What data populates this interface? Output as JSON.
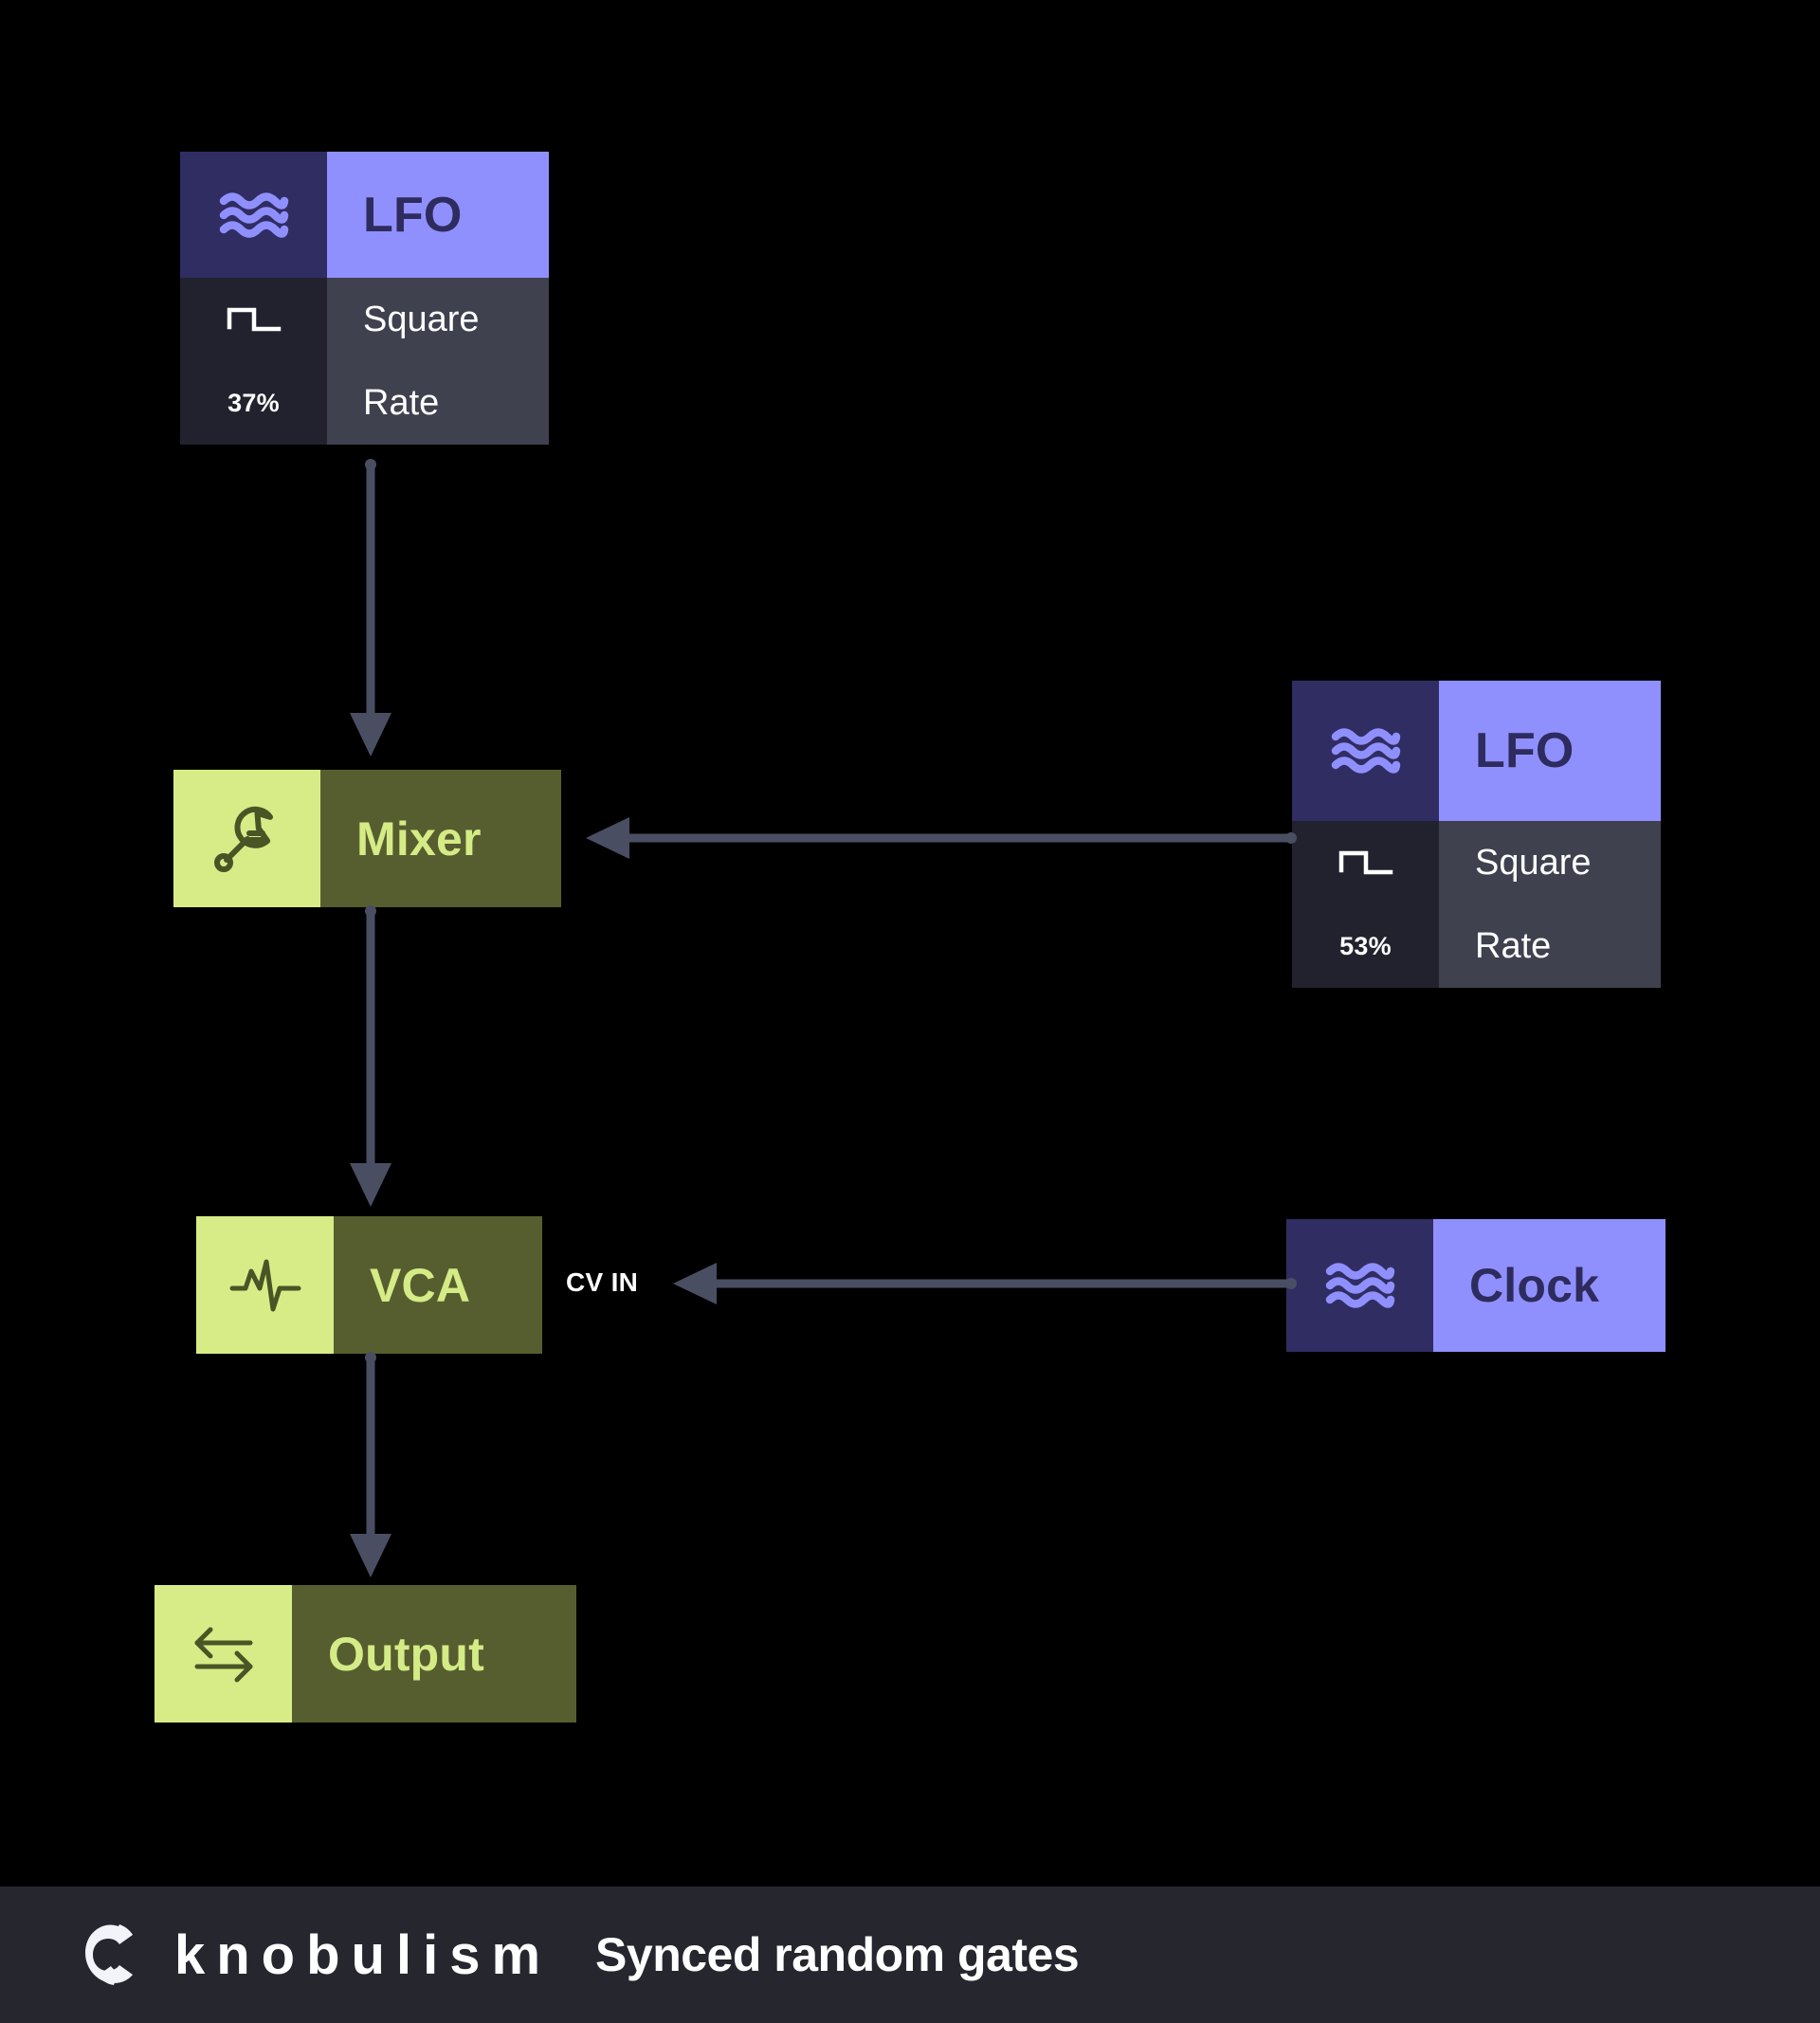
{
  "theme": {
    "background": "#000000",
    "accent_purple": "#8F90FD",
    "accent_purple_dark": "#302D62",
    "accent_lime": "#D7EC87",
    "accent_olive": "#565E30",
    "detail_icon_bg": "#22222E",
    "detail_label_bg": "#3F414F",
    "connector": "#4A4E63",
    "footer_bg": "#26262F",
    "text_light": "#FFFFFF"
  },
  "diagram": {
    "nodes": [
      {
        "id": "lfo-1",
        "title": "LFO",
        "icon": "waves-icon",
        "style": "purple",
        "details": [
          {
            "icon": "square-wave-icon",
            "label": "Square"
          },
          {
            "value": "37%",
            "label": "Rate"
          }
        ]
      },
      {
        "id": "mixer",
        "title": "Mixer",
        "icon": "wrench-icon",
        "style": "olive",
        "details": []
      },
      {
        "id": "lfo-2",
        "title": "LFO",
        "icon": "waves-icon",
        "style": "purple",
        "details": [
          {
            "icon": "square-wave-icon",
            "label": "Square"
          },
          {
            "value": "53%",
            "label": "Rate"
          }
        ]
      },
      {
        "id": "vca",
        "title": "VCA",
        "icon": "pulse-icon",
        "style": "olive",
        "details": []
      },
      {
        "id": "clock",
        "title": "Clock",
        "icon": "waves-icon",
        "style": "purple",
        "details": []
      },
      {
        "id": "output",
        "title": "Output",
        "icon": "exchange-arrows-icon",
        "style": "olive",
        "details": []
      }
    ],
    "edges": [
      {
        "id": "lfo1-to-mixer",
        "from": "lfo-1",
        "to": "mixer",
        "label": ""
      },
      {
        "id": "lfo2-to-mixer",
        "from": "lfo-2",
        "to": "mixer",
        "label": ""
      },
      {
        "id": "mixer-to-vca",
        "from": "mixer",
        "to": "vca",
        "label": ""
      },
      {
        "id": "clock-to-vca",
        "from": "clock",
        "to": "vca",
        "label": "CV IN"
      },
      {
        "id": "vca-to-output",
        "from": "vca",
        "to": "output",
        "label": ""
      }
    ]
  },
  "footer": {
    "logo": "knobulism-logo-icon",
    "brand": "knobulism",
    "caption": "Synced random gates"
  }
}
